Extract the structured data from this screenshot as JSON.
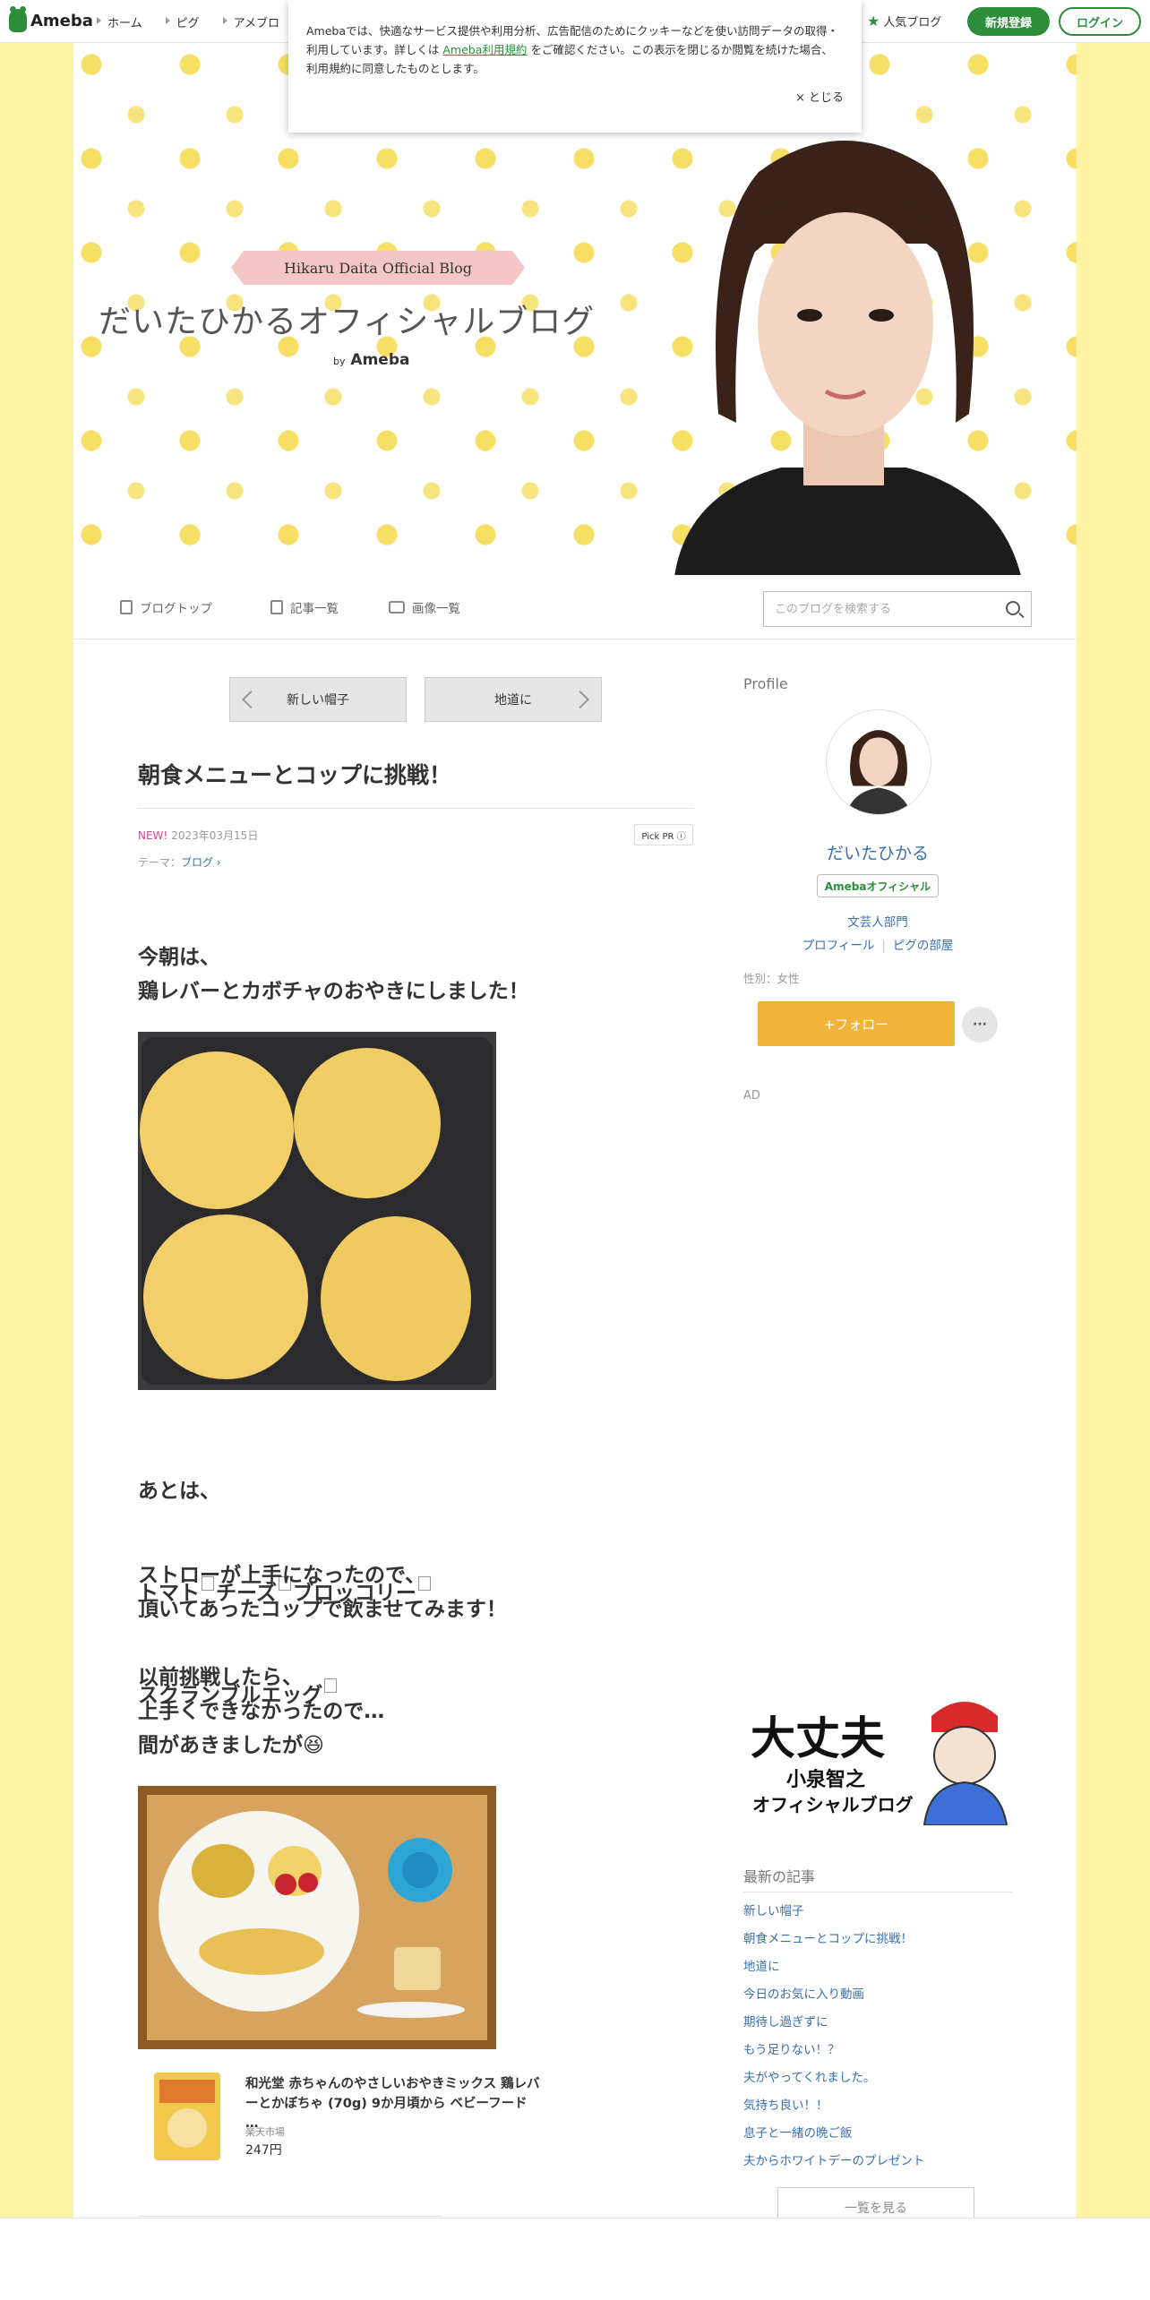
{
  "topbar": {
    "logo": "Ameba",
    "nav": [
      "ホーム",
      "ピグ",
      "アメブロ"
    ],
    "popular": "人気ブログ",
    "signup": "新規登録",
    "login": "ログイン"
  },
  "cookie": {
    "text_before": "Amebaでは、快適なサービス提供や利用分析、広告配信のためにクッキーなどを使い訪問データの取得・利用しています。詳しくは",
    "link": "Ameba利用規約",
    "text_after": "をご確認ください。この表示を閉じるか閲覧を続けた場合、利用規約に同意したものとします。",
    "close": "× とじる"
  },
  "banner": {
    "ribbon": "Hikaru Daita Official Blog",
    "title": "だいたひかるオフィシャルブログ",
    "by": "by",
    "ameba": "Ameba"
  },
  "subnav": {
    "top": "ブログトップ",
    "articles": "記事一覧",
    "images": "画像一覧",
    "search_placeholder": "このブログを検索する"
  },
  "pager": {
    "prev": "新しい帽子",
    "next": "地道に"
  },
  "article": {
    "title": "朝食メニューとコップに挑戦！",
    "new_label": "NEW!",
    "date": "2023年03月15日",
    "pickpr": "Pick PR ⓘ",
    "theme_label": "テーマ：",
    "theme": "ブログ ›",
    "p1_l1": "今朝は、",
    "p1_l2": "鶏レバーとカボチャのおやきにしました！",
    "p2_l1": "あとは、",
    "p2_tomato": "トマト",
    "p2_cheese": "チーズ",
    "p2_broccoli": "ブロッコリー",
    "p2_egg": "スクランブルエッグ",
    "p3_l1": "ストローが上手になったので、",
    "p3_l2": "頂いてあったコップで飲ませてみます！",
    "p4_l1": "以前挑戦したら、",
    "p4_l2": "上手くできなかったので…",
    "p4_l3": "間があきましたが😆",
    "product_name": "和光堂 赤ちゃんのやさしいおやきミックス 鶏レバーとかぼちゃ (70g) 9か月頃から ベビーフード …",
    "product_shop": "楽天市場",
    "product_price": "247円"
  },
  "sidebar": {
    "profile_h": "Profile",
    "name": "だいたひかる",
    "official": "Amebaオフィシャル",
    "genre": "文芸人部門",
    "profile_link": "プロフィール",
    "pig_link": "ピグの部屋",
    "gender": "性別：女性",
    "follow": "+フォロー",
    "more": "···",
    "ad": "AD",
    "ad_title": "大丈夫",
    "ad_sub1": "小泉智之",
    "ad_sub2": "オフィシャルブログ",
    "recent_h": "最新の記事",
    "recent": [
      "新しい帽子",
      "朝食メニューとコップに挑戦！",
      "地道に",
      "今日のお気に入り動画",
      "期待し過ぎずに",
      "もう足りない！？",
      "夫がやってくれました。",
      "気持ち良い！！",
      "息子と一緒の晩ご飯",
      "夫からホワイトデーのプレゼント"
    ],
    "see_all": "一覧を見る"
  }
}
